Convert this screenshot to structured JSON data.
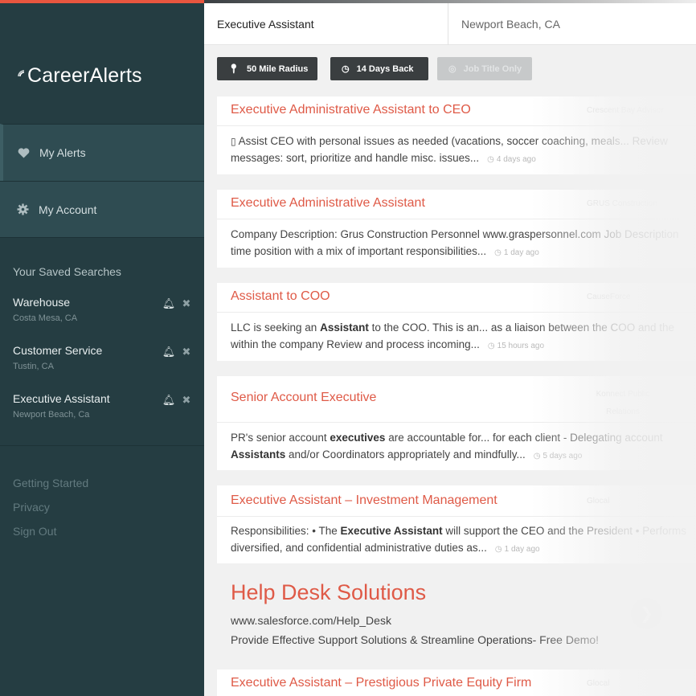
{
  "app": {
    "logo_text": "CareerAlerts"
  },
  "search": {
    "keyword": "Executive Assistant",
    "location": "Newport Beach, CA"
  },
  "filters": [
    {
      "label": "50 Mile Radius",
      "icon": "pin-icon",
      "active": true
    },
    {
      "label": "14 Days Back",
      "icon": "clock-icon",
      "active": true
    },
    {
      "label": "Job Title Only",
      "icon": "target-icon",
      "active": false
    }
  ],
  "nav": {
    "alerts_label": "My Alerts",
    "account_label": "My Account"
  },
  "saved": {
    "title": "Your Saved Searches",
    "items": [
      {
        "name": "Warehouse",
        "location": "Costa Mesa, CA"
      },
      {
        "name": "Customer Service",
        "location": "Tustin, CA"
      },
      {
        "name": "Executive Assistant",
        "location": "Newport Beach, Ca"
      }
    ]
  },
  "footer": {
    "getting_started": "Getting Started",
    "privacy": "Privacy",
    "sign_out": "Sign Out"
  },
  "jobs": [
    {
      "title": "Executive Administrative Assistant to CEO",
      "company": "Crescent Bay Advisor",
      "line1": " Assist CEO with personal issues as needed (vacations, soccer coaching, meals... Review",
      "line2": "messages: sort, prioritize and handle misc. issues...",
      "ago": "4 days ago"
    },
    {
      "title": "Executive Administrative Assistant",
      "company": "GRUS Construction",
      "line1": "Company Description: Grus Construction Personnel www.graspersonnel.com Job Description",
      "line2": "time position with a mix of important responsibilities...",
      "ago": "1 day ago"
    },
    {
      "title": "Assistant to COO",
      "company": "CauseForce",
      "line1a": "LLC is seeking an ",
      "line1b": "Assistant",
      "line1c": " to the COO. This is an... as a liaison between the COO and the",
      "line2": "within the company Review and process incoming...",
      "ago": "15 hours ago"
    },
    {
      "title": "Senior Account Executive",
      "company": "Konnect Public Relations",
      "line1a": "PR's senior account ",
      "line1b": "executives",
      "line1c": " are accountable for... for each client - Delegating account",
      "line2a": "Assistants",
      "line2c": " and/or Coordinators appropriately and mindfully...",
      "ago": "5 days ago"
    },
    {
      "title": "Executive Assistant – Investment Management",
      "company": "Glocal",
      "line1a": "Responsibilities: • The ",
      "line1b": "Executive Assistant",
      "line1c": " will support the CEO and the President • Performs",
      "line2": "diversified, and confidential administrative duties as...",
      "ago": "1 day ago"
    },
    {
      "title": "Executive Assistant – Prestigious Private Equity Firm",
      "company": "Glocal"
    }
  ],
  "ad": {
    "headline": "Help Desk Solutions",
    "url": "www.salesforce.com/Help_Desk",
    "description": "Provide Effective Support Solutions & Streamline Operations- Free Demo!"
  }
}
